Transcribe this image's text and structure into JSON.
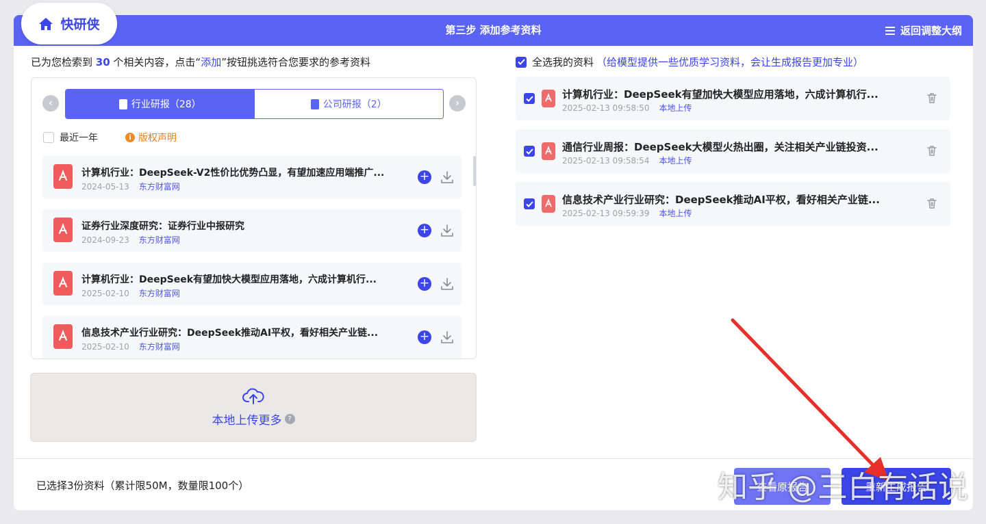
{
  "logo": {
    "text": "快研侠"
  },
  "header": {
    "step_title": "第三步 添加参考资料",
    "back_label": "返回调整大纲"
  },
  "left": {
    "summary_prefix": "已为您检索到 ",
    "summary_count": "30",
    "summary_mid": " 个相关内容，点击“",
    "summary_link": "添加",
    "summary_suffix": "”按钮挑选符合您要求的参考资料",
    "tabs": [
      {
        "label": "行业研报（28）"
      },
      {
        "label": "公司研报（2）"
      }
    ],
    "filter_recent": "最近一年",
    "copyright": "版权声明",
    "items": [
      {
        "title": "计算机行业：DeepSeek-V2性价比优势凸显，有望加速应用端推广...",
        "date": "2024-05-13",
        "source": "东方财富网"
      },
      {
        "title": "证券行业深度研究：证券行业中报研究",
        "date": "2024-09-23",
        "source": "东方财富网"
      },
      {
        "title": "计算机行业：DeepSeek有望加快大模型应用落地，六成计算机行...",
        "date": "2025-02-10",
        "source": "东方财富网"
      },
      {
        "title": "信息技术产业行业研究：DeepSeek推动AI平权，看好相关产业链...",
        "date": "2025-02-10",
        "source": "东方财富网"
      }
    ],
    "upload_label": "本地上传更多",
    "upload_help": "?"
  },
  "right": {
    "select_all_label": "全选我的资料",
    "select_all_hint": "（给模型提供一些优质学习资料，会让生成报告更加专业）",
    "items": [
      {
        "title": "计算机行业：DeepSeek有望加快大模型应用落地，六成计算机行...",
        "datetime": "2025-02-13 09:58:50",
        "source": "本地上传"
      },
      {
        "title": "通信行业周报：DeepSeek大模型火热出圈，关注相关产业链投资...",
        "datetime": "2025-02-13 09:58:54",
        "source": "本地上传"
      },
      {
        "title": "信息技术产业行业研究：DeepSeek推动AI平权，看好相关产业链...",
        "datetime": "2025-02-13 09:59:39",
        "source": "本地上传"
      }
    ]
  },
  "footer": {
    "selected_text": "已选择3份资料（累计限50M，数量限100个）",
    "btn_view": "查看原报告",
    "btn_regen": "重新生成报告"
  },
  "watermark": "知乎 @三白有话说",
  "colors": {
    "primary": "#3b45e8",
    "header": "#5b63f5",
    "pdf": "#ef5b5b",
    "annotation_arrow": "#e8302a"
  }
}
